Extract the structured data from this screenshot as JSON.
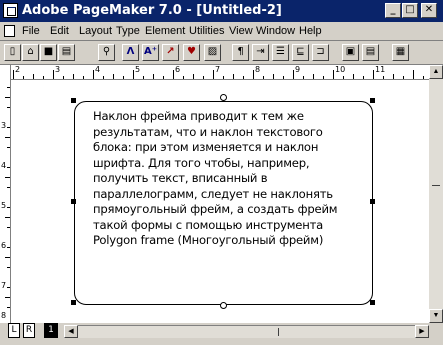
{
  "window": {
    "title": "Adobe PageMaker 7.0 - [Untitled-2]"
  },
  "caption_buttons": {
    "minimize": "_",
    "maximize": "□",
    "close": "✕"
  },
  "menu": [
    "File",
    "Edit",
    "Layout",
    "Type",
    "Element",
    "Utilities",
    "View",
    "Window",
    "Help"
  ],
  "toolbar": [
    {
      "name": "new-icon",
      "glyph": "▯"
    },
    {
      "name": "open-icon",
      "glyph": "⌂"
    },
    {
      "name": "save-icon",
      "glyph": "■"
    },
    {
      "name": "print-icon",
      "glyph": "▤"
    },
    {
      "name": "find-icon",
      "glyph": "⚲"
    },
    {
      "name": "spelling-icon",
      "glyph": "Λ"
    },
    {
      "name": "text-style-icon",
      "glyph": "A⁺"
    },
    {
      "name": "character-icon",
      "glyph": "↗"
    },
    {
      "name": "paragraph-style-icon",
      "glyph": "♥"
    },
    {
      "name": "place-icon",
      "glyph": "▨"
    },
    {
      "name": "paragraph-icon",
      "glyph": "¶"
    },
    {
      "name": "indents-icon",
      "glyph": "⇥"
    },
    {
      "name": "align-icon",
      "glyph": "☰"
    },
    {
      "name": "tabs-icon",
      "glyph": "⊑"
    },
    {
      "name": "rotate-icon",
      "glyph": "⊐"
    },
    {
      "name": "copy-icon",
      "glyph": "▣"
    },
    {
      "name": "paste-icon",
      "glyph": "▤"
    },
    {
      "name": "frame-icon",
      "glyph": "▦"
    }
  ],
  "ruler": {
    "top_labels": [
      "2",
      "3",
      "4",
      "5",
      "6",
      "7",
      "8",
      "9",
      "10",
      "11"
    ],
    "left_labels": [
      "3",
      "4",
      "5",
      "6",
      "7",
      "8"
    ]
  },
  "frame_text": "Наклон фрейма приводит к тем же результатам, что и наклон текстового блока: при этом изменяется и наклон шрифта. Для того чтобы, например, получить текст, вписанный в параллелограмм, следует не наклонять прямоугольный фрейм, а создать фрейм такой формы с помощью инструмента Polygon frame (Многоугольный фрейм)",
  "page_tabs": {
    "left": "L",
    "right": "R",
    "current": "1"
  }
}
